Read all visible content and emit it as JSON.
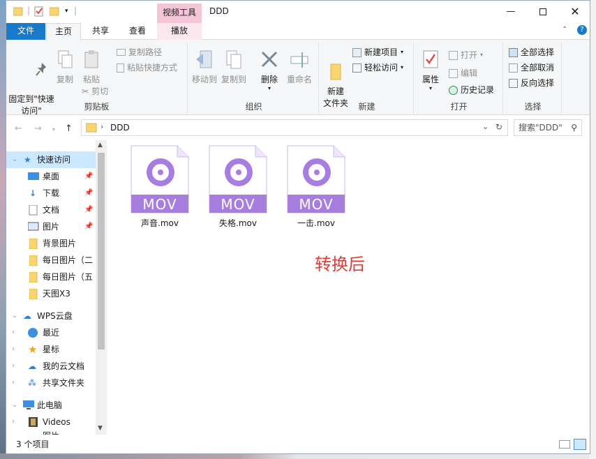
{
  "window": {
    "title": "DDD",
    "context_tab": "视频工具"
  },
  "tabs": {
    "file": "文件",
    "home": "主页",
    "share": "共享",
    "view": "查看",
    "play": "播放"
  },
  "ribbon": {
    "clipboard": {
      "label": "剪贴板",
      "pin": "固定到\"快速访问\"",
      "copy": "复制",
      "paste": "粘贴",
      "cut": "剪切",
      "copy_path": "复制路径",
      "paste_shortcut": "粘贴快捷方式"
    },
    "organize": {
      "label": "组织",
      "move_to": "移动到",
      "copy_to": "复制到",
      "delete": "删除",
      "rename": "重命名"
    },
    "new": {
      "label": "新建",
      "new_folder": "新建\n文件夹",
      "new_item": "新建项目",
      "easy_access": "轻松访问"
    },
    "open": {
      "label": "打开",
      "properties": "属性",
      "open": "打开",
      "edit": "编辑",
      "history": "历史记录"
    },
    "select": {
      "label": "选择",
      "select_all": "全部选择",
      "select_none": "全部取消",
      "invert": "反向选择"
    }
  },
  "address": {
    "path": "DDD",
    "search_placeholder": "搜索\"DDD\""
  },
  "nav": {
    "quick_access": "快速访问",
    "items": [
      {
        "label": "桌面",
        "pinned": true
      },
      {
        "label": "下载",
        "pinned": true
      },
      {
        "label": "文档",
        "pinned": true
      },
      {
        "label": "图片",
        "pinned": true
      },
      {
        "label": "背景图片"
      },
      {
        "label": "每日图片（二"
      },
      {
        "label": "每日图片（五"
      },
      {
        "label": "天图X3"
      }
    ],
    "wps": "WPS云盘",
    "wps_items": [
      "最近",
      "星标",
      "我的云文档",
      "共享文件夹"
    ],
    "this_pc": "此电脑",
    "pc_items": [
      "Videos",
      "图片"
    ]
  },
  "files": [
    {
      "name": "声音.mov",
      "badge": "MOV"
    },
    {
      "name": "失格.mov",
      "badge": "MOV"
    },
    {
      "name": "一击.mov",
      "badge": "MOV"
    }
  ],
  "annotation": "转换后",
  "status": {
    "count": "3 个项目"
  },
  "colors": {
    "accent": "#1979ca",
    "mov": "#a77de0",
    "annotation": "#e53935"
  }
}
